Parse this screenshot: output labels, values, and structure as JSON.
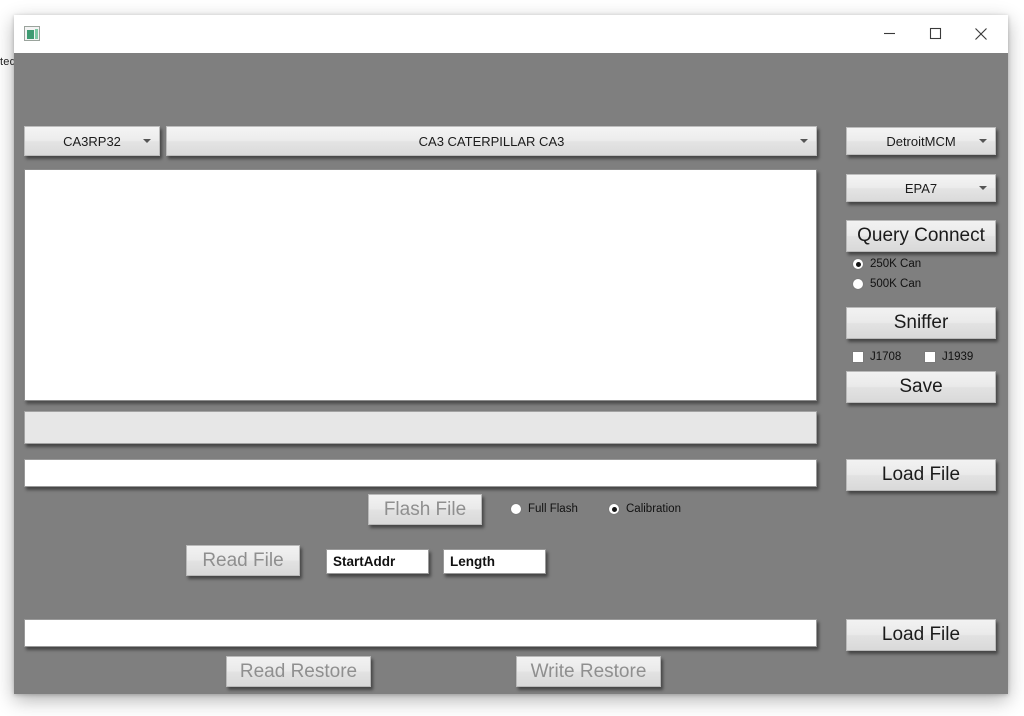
{
  "background": {
    "clipped_text": "ted"
  },
  "window": {
    "icon_name": "app-icon",
    "title": "",
    "controls": {
      "minimize": "—",
      "maximize": "□",
      "close": "×"
    }
  },
  "colors": {
    "client_bg": "#7f7f7f",
    "control_face": "#eaeaea",
    "field_bg": "#ffffff",
    "progress_bg": "#e7e7e7"
  },
  "top_row": {
    "ecu_combo_value": "CA3RP32",
    "vehicle_combo_value": "CA3 CATERPILLAR CA3"
  },
  "right_panel": {
    "brand_combo_value": "DetroitMCM",
    "emissions_combo_value": "EPA7",
    "query_connect_label": "Query Connect",
    "baud_options": [
      {
        "label": "250K Can",
        "selected": true
      },
      {
        "label": "500K Can",
        "selected": false
      }
    ],
    "sniffer_label": "Sniffer",
    "protocols": [
      {
        "label": "J1708",
        "checked": false
      },
      {
        "label": "J1939",
        "checked": false
      }
    ],
    "save_label": "Save",
    "load_file_label": "Load File",
    "load_file_restore_label": "Load File"
  },
  "main": {
    "log_listbox_value": "",
    "progress_value": "",
    "flash_path_value": "",
    "restore_path_value": ""
  },
  "flash_row": {
    "flash_file_label": "Flash File",
    "flash_file_enabled": false,
    "mode_options": [
      {
        "label": "Full Flash",
        "selected": false
      },
      {
        "label": "Calibration",
        "selected": true
      }
    ]
  },
  "read_row": {
    "read_file_label": "Read File",
    "read_file_enabled": false,
    "start_addr_value": "StartAddr",
    "length_value": "Length"
  },
  "restore_row": {
    "read_restore_label": "Read Restore",
    "write_restore_label": "Write Restore"
  }
}
